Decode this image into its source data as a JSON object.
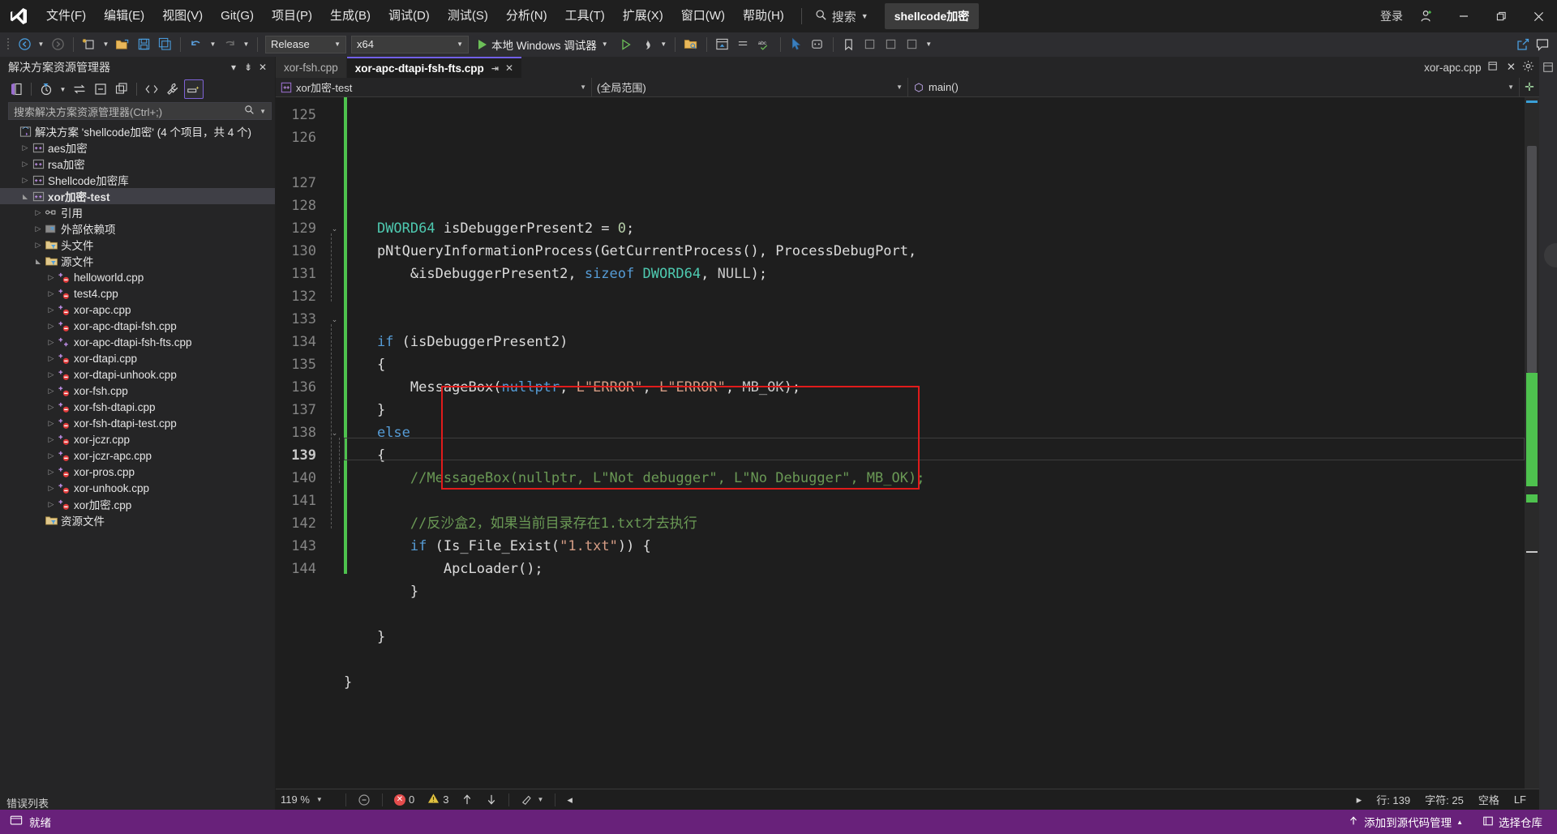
{
  "window": {
    "app_icon": "visual-studio-logo",
    "solution_chip": "shellcode加密",
    "signin_label": "登录",
    "minimize": "—",
    "maximize": "❐",
    "close": "✕"
  },
  "menu": {
    "items": [
      {
        "label": "文件(F)"
      },
      {
        "label": "编辑(E)"
      },
      {
        "label": "视图(V)"
      },
      {
        "label": "Git(G)"
      },
      {
        "label": "项目(P)"
      },
      {
        "label": "生成(B)"
      },
      {
        "label": "调试(D)"
      },
      {
        "label": "测试(S)"
      },
      {
        "label": "分析(N)"
      },
      {
        "label": "工具(T)"
      },
      {
        "label": "扩展(X)"
      },
      {
        "label": "窗口(W)"
      },
      {
        "label": "帮助(H)"
      }
    ],
    "search_placeholder": "搜索"
  },
  "toolbar": {
    "config_value": "Release",
    "platform_value": "x64",
    "run_label": "本地 Windows 调试器"
  },
  "solution_explorer": {
    "title": "解决方案资源管理器",
    "search_placeholder": "搜索解决方案资源管理器(Ctrl+;)",
    "root": "解决方案 'shellcode加密' (4 个项目，共 4 个)",
    "tree": [
      {
        "label": "解决方案 'shellcode加密' (4 个项目，共 4 个)",
        "indent": 0,
        "twist": "",
        "icon": "solution-icon",
        "selected": false
      },
      {
        "label": "aes加密",
        "indent": 1,
        "twist": "collapsed",
        "icon": "cpp-project-icon",
        "selected": false
      },
      {
        "label": "rsa加密",
        "indent": 1,
        "twist": "collapsed",
        "icon": "cpp-project-icon",
        "selected": false
      },
      {
        "label": "Shellcode加密库",
        "indent": 1,
        "twist": "collapsed",
        "icon": "cpp-project-icon",
        "selected": false
      },
      {
        "label": "xor加密-test",
        "indent": 1,
        "twist": "expanded",
        "icon": "cpp-project-icon",
        "selected": true
      },
      {
        "label": "引用",
        "indent": 2,
        "twist": "collapsed",
        "icon": "references-icon",
        "selected": false
      },
      {
        "label": "外部依赖项",
        "indent": 2,
        "twist": "collapsed",
        "icon": "external-deps-icon",
        "selected": false
      },
      {
        "label": "头文件",
        "indent": 2,
        "twist": "collapsed",
        "icon": "filter-folder-icon",
        "selected": false
      },
      {
        "label": "源文件",
        "indent": 2,
        "twist": "expanded",
        "icon": "filter-folder-icon",
        "selected": false
      },
      {
        "label": "helloworld.cpp",
        "indent": 3,
        "twist": "collapsed",
        "icon": "cpp-file-excluded-icon",
        "selected": false
      },
      {
        "label": "test4.cpp",
        "indent": 3,
        "twist": "collapsed",
        "icon": "cpp-file-excluded-icon",
        "selected": false
      },
      {
        "label": "xor-apc.cpp",
        "indent": 3,
        "twist": "collapsed",
        "icon": "cpp-file-excluded-icon",
        "selected": false
      },
      {
        "label": "xor-apc-dtapi-fsh.cpp",
        "indent": 3,
        "twist": "collapsed",
        "icon": "cpp-file-excluded-icon",
        "selected": false
      },
      {
        "label": "xor-apc-dtapi-fsh-fts.cpp",
        "indent": 3,
        "twist": "collapsed",
        "icon": "cpp-file-icon",
        "selected": false
      },
      {
        "label": "xor-dtapi.cpp",
        "indent": 3,
        "twist": "collapsed",
        "icon": "cpp-file-excluded-icon",
        "selected": false
      },
      {
        "label": "xor-dtapi-unhook.cpp",
        "indent": 3,
        "twist": "collapsed",
        "icon": "cpp-file-excluded-icon",
        "selected": false
      },
      {
        "label": "xor-fsh.cpp",
        "indent": 3,
        "twist": "collapsed",
        "icon": "cpp-file-excluded-icon",
        "selected": false
      },
      {
        "label": "xor-fsh-dtapi.cpp",
        "indent": 3,
        "twist": "collapsed",
        "icon": "cpp-file-excluded-icon",
        "selected": false
      },
      {
        "label": "xor-fsh-dtapi-test.cpp",
        "indent": 3,
        "twist": "collapsed",
        "icon": "cpp-file-excluded-icon",
        "selected": false
      },
      {
        "label": "xor-jczr.cpp",
        "indent": 3,
        "twist": "collapsed",
        "icon": "cpp-file-excluded-icon",
        "selected": false
      },
      {
        "label": "xor-jczr-apc.cpp",
        "indent": 3,
        "twist": "collapsed",
        "icon": "cpp-file-excluded-icon",
        "selected": false
      },
      {
        "label": "xor-pros.cpp",
        "indent": 3,
        "twist": "collapsed",
        "icon": "cpp-file-excluded-icon",
        "selected": false
      },
      {
        "label": "xor-unhook.cpp",
        "indent": 3,
        "twist": "collapsed",
        "icon": "cpp-file-excluded-icon",
        "selected": false
      },
      {
        "label": "xor加密.cpp",
        "indent": 3,
        "twist": "collapsed",
        "icon": "cpp-file-excluded-icon",
        "selected": false
      },
      {
        "label": "资源文件",
        "indent": 2,
        "twist": "",
        "icon": "filter-folder-icon",
        "selected": false
      }
    ],
    "footer_label": "错误列表"
  },
  "editor": {
    "tabs": [
      {
        "label": "xor-fsh.cpp",
        "active": false
      },
      {
        "label": "xor-apc-dtapi-fsh-fts.cpp",
        "active": true
      }
    ],
    "right_tab": "xor-apc.cpp",
    "nav": {
      "project": "xor加密-test",
      "scope": "(全局范围)",
      "member": "main()"
    },
    "first_line_number": 125,
    "current_line": 139,
    "lines": [
      {
        "n": 125,
        "tokens": [
          {
            "t": "    ",
            "c": "pl"
          },
          {
            "t": "DWORD64",
            "c": "typ"
          },
          {
            "t": " isDebuggerPresent2 = ",
            "c": "pl"
          },
          {
            "t": "0",
            "c": "num"
          },
          {
            "t": ";",
            "c": "pl"
          }
        ]
      },
      {
        "n": 126,
        "tokens": [
          {
            "t": "    pNtQueryInformationProcess",
            "c": "pl"
          },
          {
            "t": "(",
            "c": "pl"
          },
          {
            "t": "GetCurrentProcess",
            "c": "pl"
          },
          {
            "t": "(), ",
            "c": "pl"
          },
          {
            "t": "ProcessDebugPort",
            "c": "pl"
          },
          {
            "t": ",",
            "c": "pl"
          }
        ]
      },
      {
        "n": "",
        "tokens": [
          {
            "t": "        &isDebuggerPresent2, ",
            "c": "pl"
          },
          {
            "t": "sizeof",
            "c": "kw"
          },
          {
            "t": " ",
            "c": "pl"
          },
          {
            "t": "DWORD64",
            "c": "typ"
          },
          {
            "t": ", ",
            "c": "pl"
          },
          {
            "t": "NULL",
            "c": "mac"
          },
          {
            "t": ");",
            "c": "pl"
          }
        ]
      },
      {
        "n": 127,
        "tokens": []
      },
      {
        "n": 128,
        "tokens": []
      },
      {
        "n": 129,
        "tokens": [
          {
            "t": "    ",
            "c": "pl"
          },
          {
            "t": "if",
            "c": "kw"
          },
          {
            "t": " (isDebuggerPresent2)",
            "c": "pl"
          }
        ]
      },
      {
        "n": 130,
        "tokens": [
          {
            "t": "    {",
            "c": "pl"
          }
        ]
      },
      {
        "n": 131,
        "tokens": [
          {
            "t": "        ",
            "c": "pl"
          },
          {
            "t": "MessageBox",
            "c": "pl"
          },
          {
            "t": "(",
            "c": "pl"
          },
          {
            "t": "nullptr",
            "c": "kw"
          },
          {
            "t": ", ",
            "c": "pl"
          },
          {
            "t": "L\"ERROR\"",
            "c": "str"
          },
          {
            "t": ", ",
            "c": "pl"
          },
          {
            "t": "L\"ERROR\"",
            "c": "str"
          },
          {
            "t": ", ",
            "c": "pl"
          },
          {
            "t": "MB_OK",
            "c": "mac"
          },
          {
            "t": ");",
            "c": "pl"
          }
        ]
      },
      {
        "n": 132,
        "tokens": [
          {
            "t": "    }",
            "c": "pl"
          }
        ]
      },
      {
        "n": 133,
        "tokens": [
          {
            "t": "    ",
            "c": "pl"
          },
          {
            "t": "else",
            "c": "kw"
          }
        ]
      },
      {
        "n": 134,
        "tokens": [
          {
            "t": "    {",
            "c": "pl"
          }
        ]
      },
      {
        "n": 135,
        "tokens": [
          {
            "t": "        //MessageBox(nullptr, L\"Not debugger\", L\"No Debugger\", MB_OK);",
            "c": "cmt"
          }
        ]
      },
      {
        "n": 136,
        "tokens": []
      },
      {
        "n": 137,
        "tokens": [
          {
            "t": "        //反沙盒2，如果当前目录存在1.txt才去执行",
            "c": "cmt"
          }
        ]
      },
      {
        "n": 138,
        "tokens": [
          {
            "t": "        ",
            "c": "pl"
          },
          {
            "t": "if",
            "c": "kw"
          },
          {
            "t": " (",
            "c": "pl"
          },
          {
            "t": "Is_File_Exist",
            "c": "pl"
          },
          {
            "t": "(",
            "c": "pl"
          },
          {
            "t": "\"1.txt\"",
            "c": "str"
          },
          {
            "t": ")) {",
            "c": "pl"
          }
        ]
      },
      {
        "n": 139,
        "tokens": [
          {
            "t": "            ",
            "c": "pl"
          },
          {
            "t": "ApcLoader",
            "c": "pl"
          },
          {
            "t": "();",
            "c": "pl"
          }
        ]
      },
      {
        "n": 140,
        "tokens": [
          {
            "t": "        }",
            "c": "pl"
          }
        ]
      },
      {
        "n": 141,
        "tokens": []
      },
      {
        "n": 142,
        "tokens": [
          {
            "t": "    }",
            "c": "pl"
          }
        ]
      },
      {
        "n": 143,
        "tokens": []
      },
      {
        "n": 144,
        "tokens": [
          {
            "t": "}",
            "c": "pl"
          }
        ]
      }
    ],
    "status": {
      "zoom": "119 %",
      "errors": "0",
      "warnings": "3",
      "line_label": "行: 139",
      "col_label": "字符: 25",
      "spaces_label": "空格",
      "eol_label": "LF"
    }
  },
  "status_bar": {
    "ready": "就绪",
    "source_control": "添加到源代码管理",
    "repo": "选择仓库"
  },
  "colors": {
    "accent_purple": "#68217a",
    "tab_active_border": "#7160e8",
    "highlight_red": "#e01b1b",
    "change_green": "#4ec24e",
    "comment_green": "#6a9955",
    "string_orange": "#d69d85",
    "keyword_blue": "#569cd6",
    "type_teal": "#4ec9b0"
  }
}
